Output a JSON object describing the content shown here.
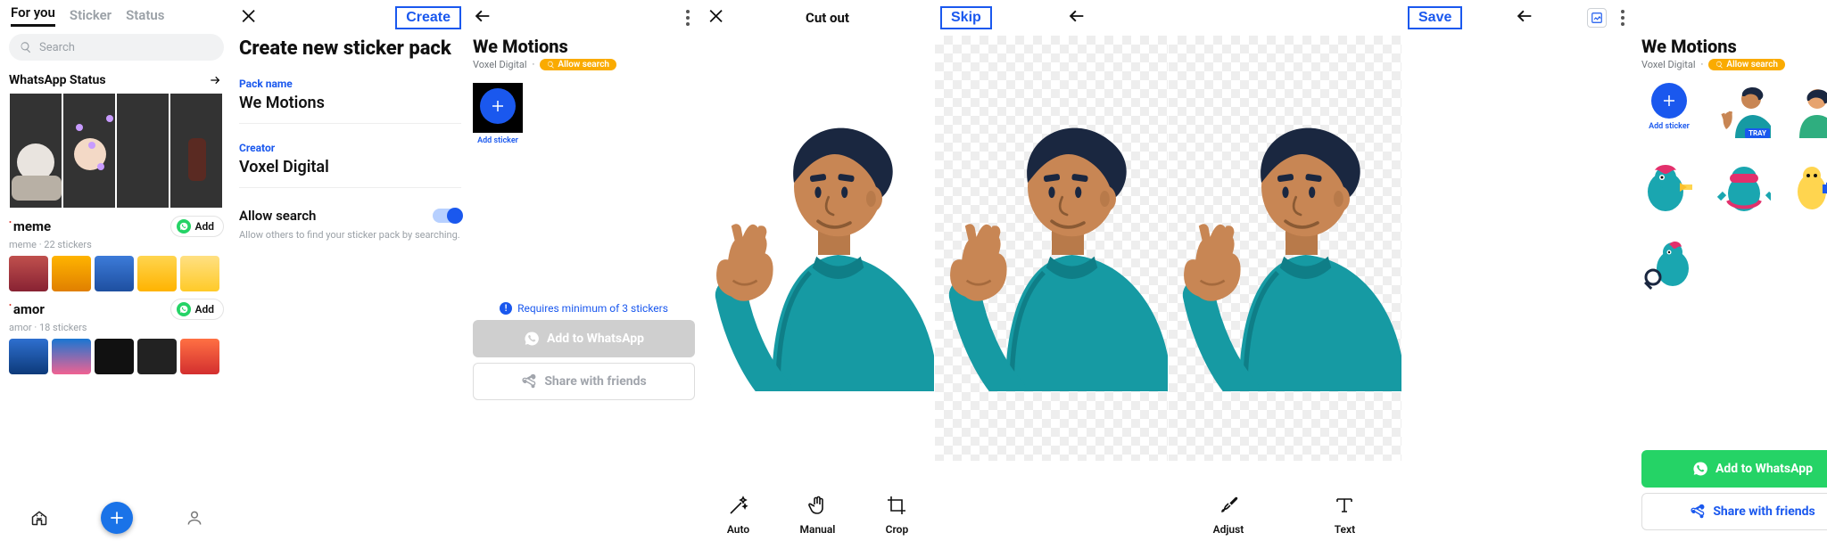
{
  "s1": {
    "tabs": [
      "For you",
      "Sticker",
      "Status"
    ],
    "search_placeholder": "Search",
    "status_heading": "WhatsApp Status",
    "packs": [
      {
        "title": "meme",
        "sub": "meme · 22 stickers",
        "add_label": "Add"
      },
      {
        "title": "amor",
        "sub": "amor · 18 stickers",
        "add_label": "Add"
      }
    ]
  },
  "s2": {
    "create_btn": "Create",
    "title": "Create new sticker pack",
    "pack_name_label": "Pack name",
    "pack_name_value": "We Motions",
    "creator_label": "Creator",
    "creator_value": "Voxel Digital",
    "allow_search_label": "Allow search",
    "allow_search_hint": "Allow others to find your sticker pack by searching."
  },
  "s3": {
    "title": "We Motions",
    "creator": "Voxel Digital",
    "chip": "Allow search",
    "add_sticker": "Add sticker",
    "warning": "Requires minimum of 3 stickers",
    "btn_whatsapp": "Add to WhatsApp",
    "btn_share": "Share with friends"
  },
  "editor_cutout": {
    "title": "Cut out",
    "skip": "Skip",
    "tools": [
      "Auto",
      "Manual",
      "Crop"
    ]
  },
  "editor_save": {
    "save": "Save",
    "tools": [
      "Adjust",
      "Text"
    ]
  },
  "s8": {
    "title": "We Motions",
    "creator": "Voxel Digital",
    "chip": "Allow search",
    "add_sticker": "Add sticker",
    "tray": "TRAY",
    "btn_whatsapp": "Add to WhatsApp",
    "btn_share": "Share with friends"
  }
}
